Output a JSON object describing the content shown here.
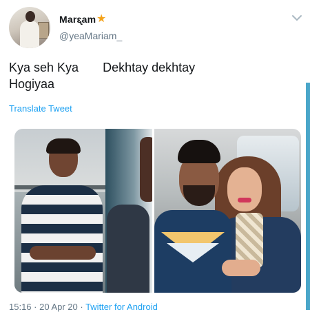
{
  "author": {
    "display_name": "Marᶓam",
    "verified_star": "★",
    "handle": "@yeaMariam_"
  },
  "tweet": {
    "text": "Kya seh Kya       Dekhtay dekhtay\nHogiyaa",
    "translate_label": "Translate Tweet",
    "timestamp": "15:16 · 20 Apr 20 · ",
    "source": "Twitter for Android"
  },
  "icons": {
    "more": "chevron-down-icon",
    "badge": "star-icon"
  },
  "colors": {
    "link": "#1da1f2",
    "secondary_text": "#657786",
    "star": "#f4a21a"
  }
}
